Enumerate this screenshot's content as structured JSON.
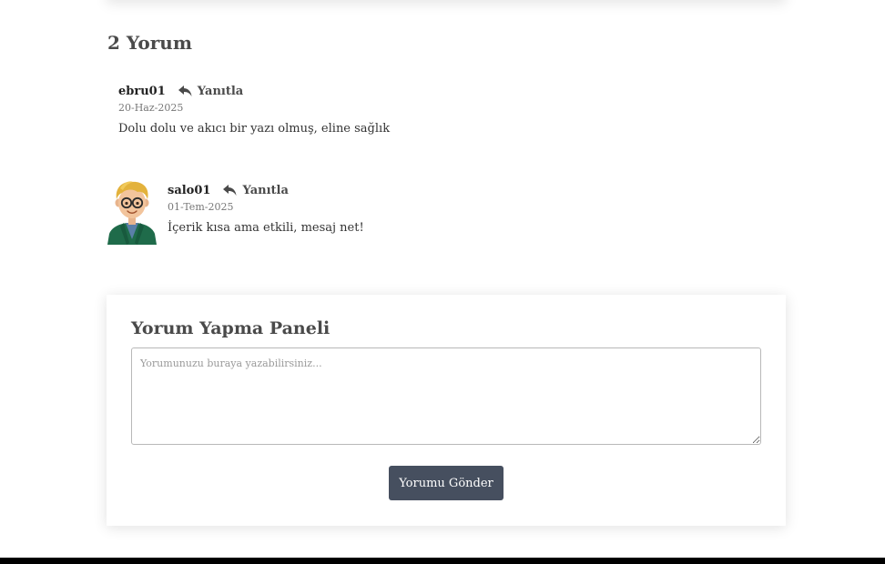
{
  "comments_section": {
    "title": "2 Yorum",
    "reply_label": "Yanıtla",
    "comments": [
      {
        "author": "ebru01",
        "date": "20-Haz-2025",
        "text": "Dolu dolu ve akıcı bir yazı olmuş, eline sağlık",
        "has_avatar": false
      },
      {
        "author": "salo01",
        "date": "01-Tem-2025",
        "text": "İçerik kısa ama etkili, mesaj net!",
        "has_avatar": true,
        "avatar_icon": "cartoon-boy-glasses-avatar"
      }
    ]
  },
  "comment_form": {
    "title": "Yorum Yapma Paneli",
    "placeholder": "Yorumunuzu buraya yazabilirsiniz...",
    "value": "",
    "submit_label": "Yorumu Gönder"
  },
  "colors": {
    "button_bg": "#464f5f",
    "heading": "#4a4a4a",
    "footer": "#000000"
  },
  "icons": {
    "reply": "reply-arrow-icon",
    "resize": "resize-handle-icon"
  }
}
